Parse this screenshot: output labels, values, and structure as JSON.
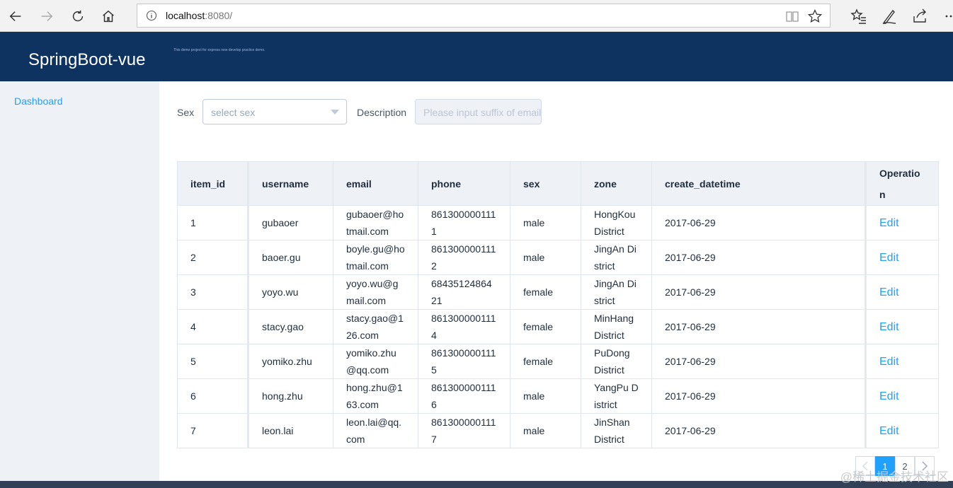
{
  "browser": {
    "url_host": "localhost",
    "url_port": ":8080/",
    "icons": [
      "back-icon",
      "forward-icon",
      "refresh-icon",
      "home-icon",
      "info-icon",
      "reading-view-icon",
      "favorite-star-icon",
      "favorites-hub-icon",
      "pen-icon",
      "share-icon",
      "more-icon"
    ]
  },
  "header": {
    "title": "SpringBoot-vue",
    "description": "This demo project for express new develop practice demo."
  },
  "sidebar": {
    "items": [
      {
        "label": "Dashboard"
      }
    ]
  },
  "filters": {
    "sex_label": "Sex",
    "sex_placeholder": "select sex",
    "description_label": "Description",
    "description_placeholder": "Please input suffix of email"
  },
  "table": {
    "columns": [
      "item_id",
      "username",
      "email",
      "phone",
      "sex",
      "zone",
      "create_datetime",
      "Operation"
    ],
    "rows": [
      {
        "item_id": "1",
        "username": "gubaoer",
        "email": "gubaoer@hotmail.com",
        "phone": "8613000001111",
        "sex": "male",
        "zone": "HongKou District",
        "create_datetime": "2017-06-29",
        "action": "Edit"
      },
      {
        "item_id": "2",
        "username": "baoer.gu",
        "email": "boyle.gu@hotmail.com",
        "phone": "8613000001112",
        "sex": "male",
        "zone": "JingAn District",
        "create_datetime": "2017-06-29",
        "action": "Edit"
      },
      {
        "item_id": "3",
        "username": "yoyo.wu",
        "email": "yoyo.wu@gmail.com",
        "phone": "6843512486421",
        "sex": "female",
        "zone": "JingAn District",
        "create_datetime": "2017-06-29",
        "action": "Edit"
      },
      {
        "item_id": "4",
        "username": "stacy.gao",
        "email": "stacy.gao@126.com",
        "phone": "8613000001114",
        "sex": "female",
        "zone": "MinHang District",
        "create_datetime": "2017-06-29",
        "action": "Edit"
      },
      {
        "item_id": "5",
        "username": "yomiko.zhu",
        "email": "yomiko.zhu@qq.com",
        "phone": "8613000001115",
        "sex": "female",
        "zone": "PuDong District",
        "create_datetime": "2017-06-29",
        "action": "Edit"
      },
      {
        "item_id": "6",
        "username": "hong.zhu",
        "email": "hong.zhu@163.com",
        "phone": "8613000001116",
        "sex": "male",
        "zone": "YangPu District",
        "create_datetime": "2017-06-29",
        "action": "Edit"
      },
      {
        "item_id": "7",
        "username": "leon.lai",
        "email": "leon.lai@qq.com",
        "phone": "8613000001117",
        "sex": "male",
        "zone": "JinShan District",
        "create_datetime": "2017-06-29",
        "action": "Edit"
      }
    ]
  },
  "pagination": {
    "pages": [
      "1",
      "2"
    ],
    "current": "1",
    "prev_icon": "chevron-left-icon",
    "next_icon": "chevron-right-icon"
  },
  "watermark": "@稀土掘金技术社区",
  "colors": {
    "header_bg": "#0f3360",
    "accent": "#20a0ff",
    "sidebar_bg": "#eef1f6",
    "footer_bg": "#324157"
  }
}
